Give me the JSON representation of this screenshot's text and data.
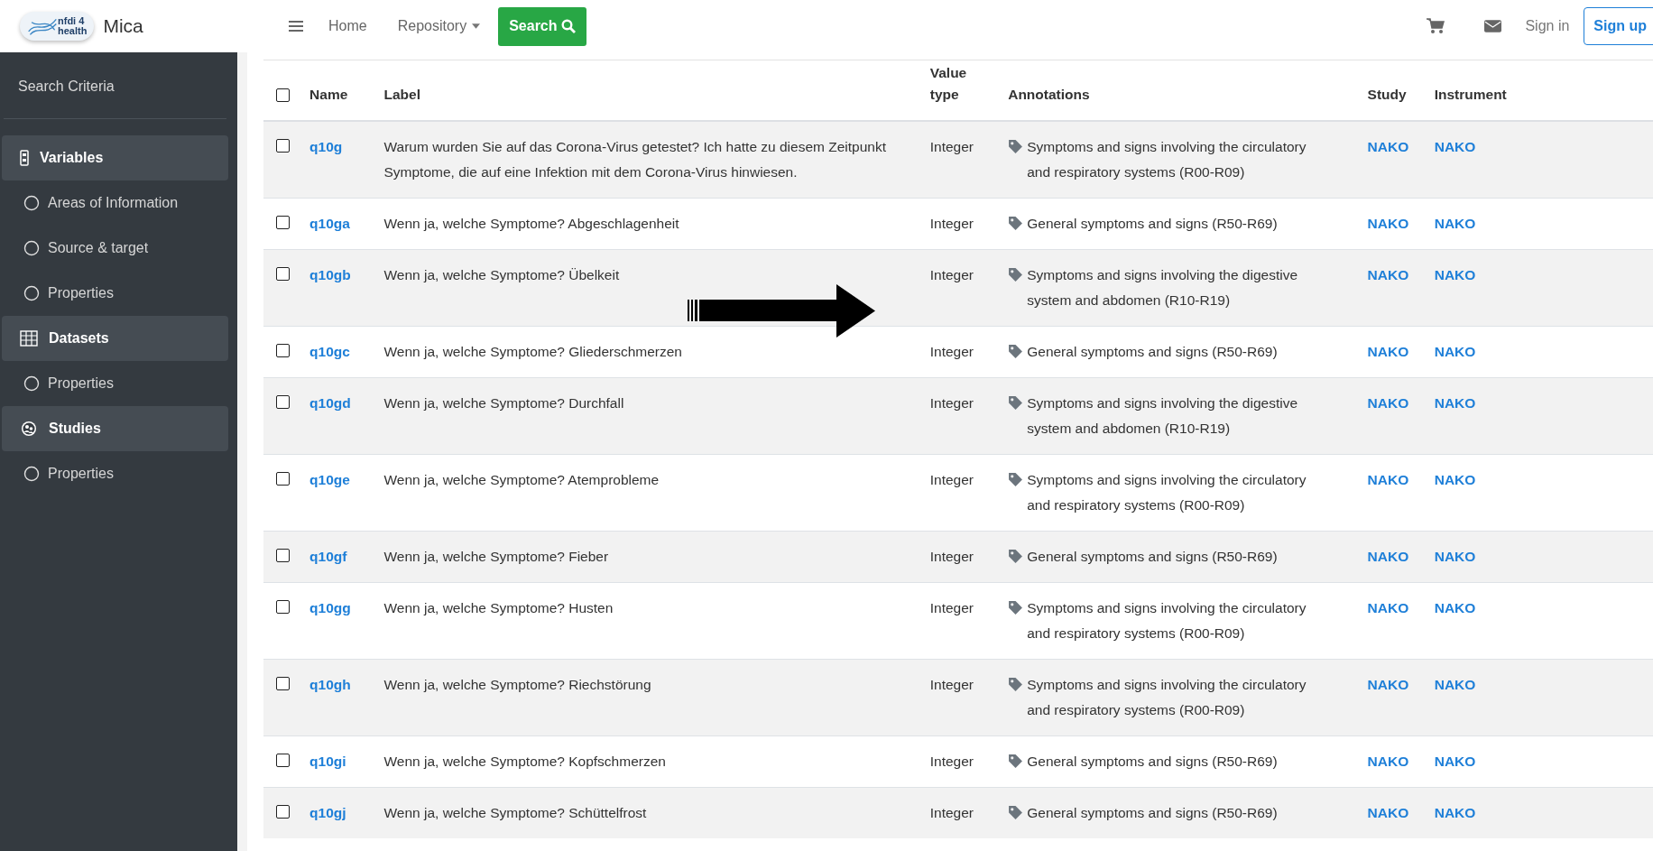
{
  "logo": {
    "lines": [
      "nfdi 4",
      "health"
    ]
  },
  "app_name": "Mica",
  "nav": {
    "items": [
      {
        "label": "Home",
        "dropdown": false
      },
      {
        "label": "Repository",
        "dropdown": true
      }
    ],
    "search_button": "Search",
    "sign_in": "Sign in",
    "sign_up": "Sign up"
  },
  "sidebar": {
    "title": "Search Criteria",
    "items": [
      {
        "kind": "section",
        "label": "Variables"
      },
      {
        "kind": "option",
        "label": "Areas of Information",
        "selected": false
      },
      {
        "kind": "option",
        "label": "Source & target",
        "selected": false
      },
      {
        "kind": "option",
        "label": "Properties",
        "selected": false
      },
      {
        "kind": "section",
        "label": "Datasets"
      },
      {
        "kind": "option",
        "label": "Properties",
        "selected": false
      },
      {
        "kind": "section",
        "label": "Studies"
      },
      {
        "kind": "option",
        "label": "Properties",
        "selected": false
      }
    ]
  },
  "table": {
    "select_all": {
      "checked": false
    },
    "columns": [
      "Name",
      "Label",
      "Value type",
      "Annotations",
      "Study",
      "Instrument"
    ],
    "rows": [
      {
        "checked": false,
        "name": "q10g",
        "label": "Warum wurden Sie auf das Corona-Virus getestet? Ich hatte zu diesem Zeitpunkt Symptome, die auf eine Infektion mit dem Corona-Virus hinwiesen.",
        "value_type": "Integer",
        "annotation": "Symptoms and signs involving the circulatory and respiratory systems (R00-R09)",
        "study": "NAKO",
        "instrument": "NAKO"
      },
      {
        "checked": false,
        "name": "q10ga",
        "label": "Wenn ja, welche Symptome? Abgeschlagenheit",
        "value_type": "Integer",
        "annotation": "General symptoms and signs (R50-R69)",
        "study": "NAKO",
        "instrument": "NAKO"
      },
      {
        "checked": false,
        "name": "q10gb",
        "label": "Wenn ja, welche Symptome? Übelkeit",
        "value_type": "Integer",
        "annotation": "Symptoms and signs involving the digestive system and abdomen (R10-R19)",
        "study": "NAKO",
        "instrument": "NAKO"
      },
      {
        "checked": false,
        "name": "q10gc",
        "label": "Wenn ja, welche Symptome? Gliederschmerzen",
        "value_type": "Integer",
        "annotation": "General symptoms and signs (R50-R69)",
        "study": "NAKO",
        "instrument": "NAKO"
      },
      {
        "checked": false,
        "name": "q10gd",
        "label": "Wenn ja, welche Symptome? Durchfall",
        "value_type": "Integer",
        "annotation": "Symptoms and signs involving the digestive system and abdomen (R10-R19)",
        "study": "NAKO",
        "instrument": "NAKO"
      },
      {
        "checked": false,
        "name": "q10ge",
        "label": "Wenn ja, welche Symptome? Atemprobleme",
        "value_type": "Integer",
        "annotation": "Symptoms and signs involving the circulatory and respiratory systems (R00-R09)",
        "study": "NAKO",
        "instrument": "NAKO"
      },
      {
        "checked": false,
        "name": "q10gf",
        "label": "Wenn ja, welche Symptome? Fieber",
        "value_type": "Integer",
        "annotation": "General symptoms and signs (R50-R69)",
        "study": "NAKO",
        "instrument": "NAKO"
      },
      {
        "checked": false,
        "name": "q10gg",
        "label": "Wenn ja, welche Symptome? Husten",
        "value_type": "Integer",
        "annotation": "Symptoms and signs involving the circulatory and respiratory systems (R00-R09)",
        "study": "NAKO",
        "instrument": "NAKO"
      },
      {
        "checked": false,
        "name": "q10gh",
        "label": "Wenn ja, welche Symptome? Riechstörung",
        "value_type": "Integer",
        "annotation": "Symptoms and signs involving the circulatory and respiratory systems (R00-R09)",
        "study": "NAKO",
        "instrument": "NAKO"
      },
      {
        "checked": false,
        "name": "q10gi",
        "label": "Wenn ja, welche Symptome? Kopfschmerzen",
        "value_type": "Integer",
        "annotation": "General symptoms and signs (R50-R69)",
        "study": "NAKO",
        "instrument": "NAKO"
      },
      {
        "checked": false,
        "name": "q10gj",
        "label": "Wenn ja, welche Symptome? Schüttelfrost",
        "value_type": "Integer",
        "annotation": "General symptoms and signs (R50-R69)",
        "study": "NAKO",
        "instrument": "NAKO"
      }
    ]
  }
}
